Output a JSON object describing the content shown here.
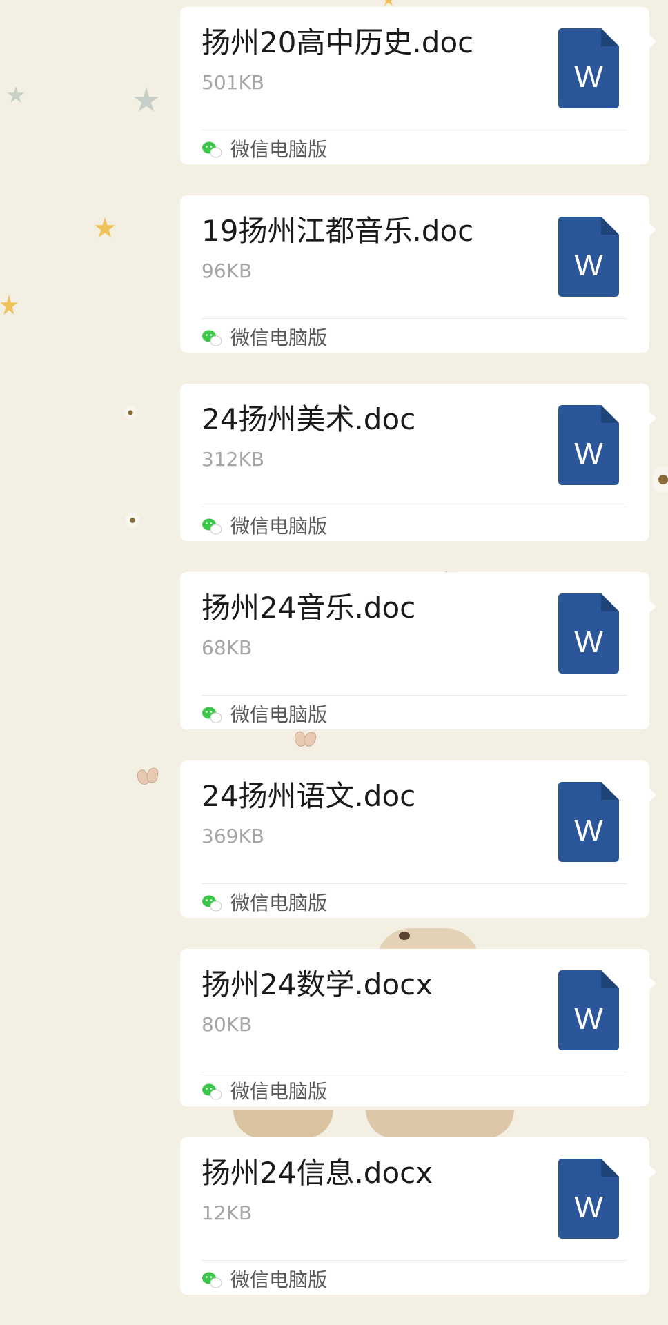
{
  "messages": [
    {
      "name": "扬州20高中历史.doc",
      "size": "501KB",
      "source": "微信电脑版",
      "icon": "word-doc-icon"
    },
    {
      "name": "19扬州江都音乐.doc",
      "size": "96KB",
      "source": "微信电脑版",
      "icon": "word-doc-icon"
    },
    {
      "name": "24扬州美术.doc",
      "size": "312KB",
      "source": "微信电脑版",
      "icon": "word-doc-icon"
    },
    {
      "name": "扬州24音乐.doc",
      "size": "68KB",
      "source": "微信电脑版",
      "icon": "word-doc-icon"
    },
    {
      "name": "24扬州语文.doc",
      "size": "369KB",
      "source": "微信电脑版",
      "icon": "word-doc-icon"
    },
    {
      "name": "扬州24数学.docx",
      "size": "80KB",
      "source": "微信电脑版",
      "icon": "word-doc-icon"
    },
    {
      "name": "扬州24信息.docx",
      "size": "12KB",
      "source": "微信电脑版",
      "icon": "word-doc-icon"
    }
  ],
  "word_icon_letter": "W",
  "colors": {
    "background": "#f3efe3",
    "bubble": "#ffffff",
    "word_blue": "#2b579a",
    "wechat_green": "#3cc74a",
    "size_gray": "#a6a6a6"
  }
}
